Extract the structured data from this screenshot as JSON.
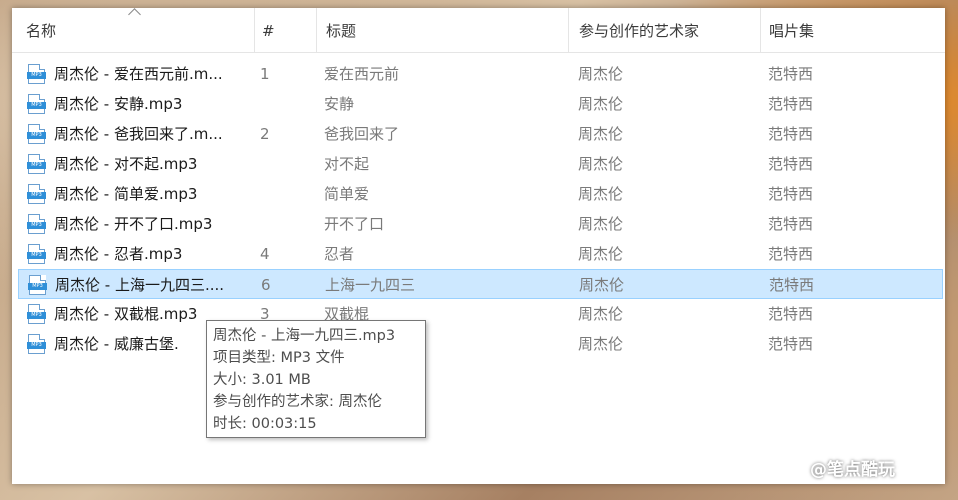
{
  "header": {
    "columns": [
      {
        "label": "名称"
      },
      {
        "label": "#"
      },
      {
        "label": "标题"
      },
      {
        "label": "参与创作的艺术家"
      },
      {
        "label": "唱片集"
      }
    ]
  },
  "file_icon_label": "MP3",
  "rows": [
    {
      "name": "周杰伦 - 爱在西元前.m...",
      "num": "1",
      "title": "爱在西元前",
      "artist": "周杰伦",
      "album": "范特西"
    },
    {
      "name": "周杰伦 - 安静.mp3",
      "num": "",
      "title": "安静",
      "artist": "周杰伦",
      "album": "范特西"
    },
    {
      "name": "周杰伦 - 爸我回来了.m...",
      "num": "2",
      "title": "爸我回来了",
      "artist": "周杰伦",
      "album": "范特西"
    },
    {
      "name": "周杰伦 - 对不起.mp3",
      "num": "",
      "title": "对不起",
      "artist": "周杰伦",
      "album": "范特西"
    },
    {
      "name": "周杰伦 - 简单爱.mp3",
      "num": "",
      "title": "简单爱",
      "artist": "周杰伦",
      "album": "范特西"
    },
    {
      "name": "周杰伦 - 开不了口.mp3",
      "num": "",
      "title": "开不了口",
      "artist": "周杰伦",
      "album": "范特西"
    },
    {
      "name": "周杰伦 - 忍者.mp3",
      "num": "4",
      "title": "忍者",
      "artist": "周杰伦",
      "album": "范特西"
    },
    {
      "name": "周杰伦 - 上海一九四三....",
      "num": "6",
      "title": "上海一九四三",
      "artist": "周杰伦",
      "album": "范特西"
    },
    {
      "name": "周杰伦 - 双截棍.mp3",
      "num": "3",
      "title": "双截棍",
      "artist": "周杰伦",
      "album": "范特西"
    },
    {
      "name": "周杰伦 - 威廉古堡.",
      "num": "",
      "title": "",
      "artist": "周杰伦",
      "album": "范特西"
    }
  ],
  "tooltip": {
    "line1": "周杰伦 - 上海一九四三.mp3",
    "line2": "项目类型: MP3 文件",
    "line3": "大小: 3.01 MB",
    "line4": "参与创作的艺术家: 周杰伦",
    "line5": "时长: 00:03:15"
  },
  "watermark": "@笔点酷玩",
  "colors": {
    "selection": "#cde8ff",
    "selection_border": "#99d1ff",
    "icon_blue": "#2f8fd8"
  }
}
